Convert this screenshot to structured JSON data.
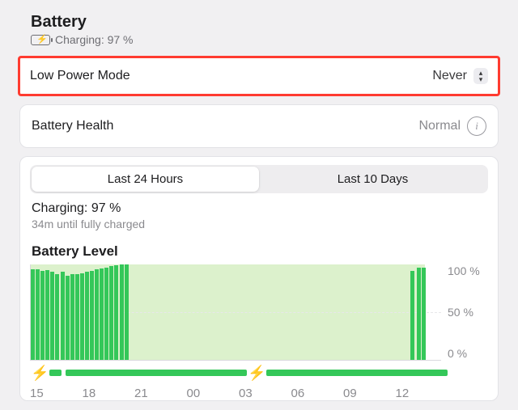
{
  "header": {
    "title": "Battery",
    "status": "Charging: 97 %"
  },
  "low_power_mode": {
    "label": "Low Power Mode",
    "value": "Never"
  },
  "battery_health": {
    "label": "Battery Health",
    "value": "Normal"
  },
  "tabs": {
    "t24h": "Last 24 Hours",
    "t10d": "Last 10 Days"
  },
  "charging_status": {
    "line": "Charging: 97 %",
    "sub": "34m until fully charged"
  },
  "chart": {
    "title": "Battery Level",
    "y100": "100 %",
    "y50": "50 %",
    "y0": "0 %"
  },
  "xaxis": {
    "t0": "15",
    "t1": "18",
    "t2": "21",
    "t3": "00",
    "t4": "03",
    "t5": "06",
    "t6": "09",
    "t7": "12"
  },
  "chart_data": {
    "type": "bar",
    "title": "Battery Level",
    "xlabel": "",
    "ylabel": "",
    "ylim": [
      0,
      100
    ],
    "categories": [
      "15",
      "16",
      "17",
      "18",
      "19",
      "20",
      "21",
      "22",
      "23",
      "00",
      "01",
      "02",
      "03",
      "04",
      "05",
      "06",
      "07",
      "08",
      "09",
      "10",
      "11",
      "12",
      "13"
    ],
    "values": [
      95,
      94,
      90,
      92,
      97,
      100,
      100,
      100,
      100,
      100,
      100,
      100,
      100,
      100,
      100,
      100,
      100,
      100,
      100,
      100,
      100,
      93,
      97
    ],
    "dense_region_end_hour": "20",
    "spikes_at": [
      "12",
      "13"
    ],
    "charging_intervals": [
      {
        "from_hour": "15",
        "to_hour": "16"
      },
      {
        "from_hour": "16",
        "to_hour": "12"
      }
    ],
    "y_ticks": [
      0,
      50,
      100
    ]
  }
}
